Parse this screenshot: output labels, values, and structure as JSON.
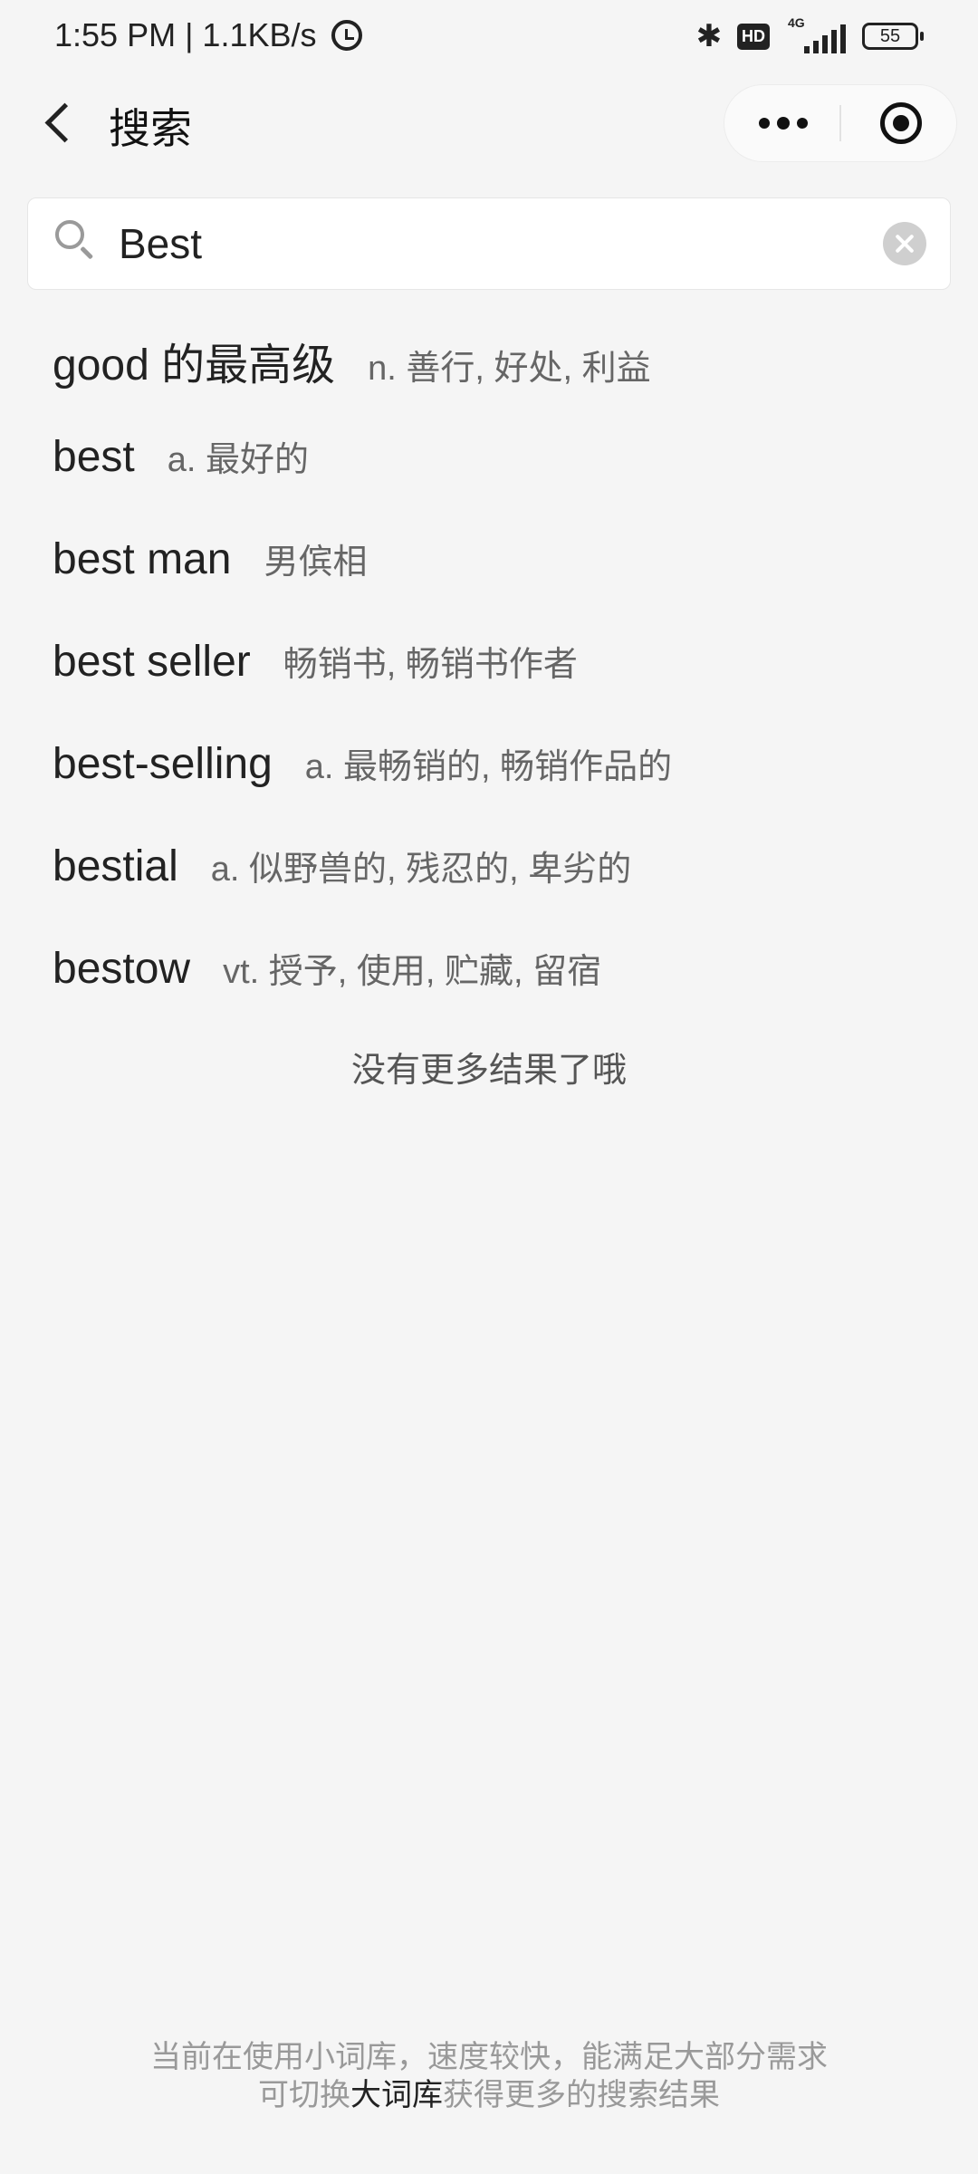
{
  "status_bar": {
    "time_speed": "1:55 PM | 1.1KB/s",
    "hd": "HD",
    "network": "4G",
    "battery": "55",
    "icons": [
      "alarm-icon",
      "bluetooth-icon",
      "hd-icon",
      "signal-icon",
      "battery-icon"
    ]
  },
  "nav": {
    "title": "搜索",
    "icons": [
      "back-arrow-icon",
      "more-dots-icon",
      "target-icon"
    ]
  },
  "search": {
    "value": "Best",
    "icons": [
      "search-icon",
      "clear-icon"
    ]
  },
  "results": [
    {
      "word": "good 的最高级",
      "definition": "n. 善行, 好处, 利益"
    },
    {
      "word": "best",
      "definition": "a. 最好的"
    },
    {
      "word": "best man",
      "definition": "男傧相"
    },
    {
      "word": "best seller",
      "definition": "畅销书, 畅销书作者"
    },
    {
      "word": "best-selling",
      "definition": "a. 最畅销的, 畅销作品的"
    },
    {
      "word": "bestial",
      "definition": "a. 似野兽的, 残忍的, 卑劣的"
    },
    {
      "word": "bestow",
      "definition": "vt. 授予, 使用, 贮藏, 留宿"
    }
  ],
  "no_more": "没有更多结果了哦",
  "footer": {
    "line1": "当前在使用小词库，速度较快，能满足大部分需求",
    "line2_prefix": "可切换",
    "line2_link": "大词库",
    "line2_suffix": "获得更多的搜索结果"
  },
  "colors": {
    "background": "#f5f5f5",
    "text_primary": "#222222",
    "text_secondary": "#666666",
    "text_muted": "#999999"
  }
}
